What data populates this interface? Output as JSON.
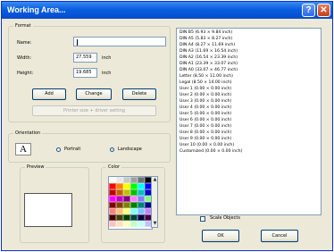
{
  "window": {
    "title": "Working Area..."
  },
  "format": {
    "group_label": "Format",
    "name_label": "Name:",
    "name_value": "",
    "width_label": "Width:",
    "width_value": "27.559",
    "width_unit": "inch",
    "height_label": "Height:",
    "height_value": "19.685",
    "height_unit": "inch",
    "add_label": "Add",
    "change_label": "Change",
    "delete_label": "Delete",
    "wide_button_label": "Printer size + driver setting"
  },
  "orientation": {
    "group_label": "Orientation",
    "icon_glyph": "A",
    "portrait_label": "Portrait",
    "landscape_label": "Landscape",
    "selected": "Landscape"
  },
  "preview": {
    "group_label": "Preview"
  },
  "color": {
    "group_label": "Color",
    "swatches": [
      "#ffffff",
      "#e8e8e8",
      "#c8c8c8",
      "#a0a0a0",
      "#707070",
      "#000000",
      "#ff0000",
      "#ff8000",
      "#ffff00",
      "#00ff00",
      "#00ffff",
      "#0000ff",
      "#c00000",
      "#c06000",
      "#c0c000",
      "#00c000",
      "#00c0c0",
      "#0000c0",
      "#ff00ff",
      "#c000c0",
      "#800080",
      "#ff80ff",
      "#8080ff",
      "#80ff80",
      "#800000",
      "#804000",
      "#808000",
      "#008000",
      "#008080",
      "#000080",
      "#ff8080",
      "#ffc080",
      "#ffff80",
      "#80ffff",
      "#80c0ff",
      "#c080ff",
      "#400000",
      "#404000",
      "#004000",
      "#004040",
      "#000040",
      "#400040",
      "#ffc0c0",
      "#ffe0c0",
      "#ffffc0",
      "#c0ffc0",
      "#c0ffff",
      "#c0c0ff"
    ]
  },
  "sizes": {
    "items": [
      "DIN B5 (6.93 × 9.84 inch)",
      "DIN A5 (5.83 × 8.27 inch)",
      "DIN A4 (8.27 × 11.69 inch)",
      "DIN A3 (11.69 × 16.54 inch)",
      "DIN A2 (16.54 × 23.39 inch)",
      "DIN A1 (23.39 × 33.07 inch)",
      "DIN A0 (33.07 × 46.77 inch)",
      "Letter (8.50 × 11.00 inch)",
      "Legal (8.50 × 14.00 inch)",
      "User 1 (0.00 × 0.00 inch)",
      "User 2 (0.00 × 0.00 inch)",
      "User 3 (0.00 × 0.00 inch)",
      "User 4 (0.00 × 0.00 inch)",
      "User 5 (0.00 × 0.00 inch)",
      "User 6 (0.00 × 0.00 inch)",
      "User 7 (0.00 × 0.00 inch)",
      "User 8 (0.00 × 0.00 inch)",
      "User 9 (0.00 × 0.00 inch)",
      "User 10 (0.00 × 0.00 inch)",
      "Customized (0.00 × 0.00 inch)"
    ]
  },
  "footer": {
    "scale_objects_label": "Scale Objects",
    "ok_label": "OK",
    "cancel_label": "Cancel"
  }
}
